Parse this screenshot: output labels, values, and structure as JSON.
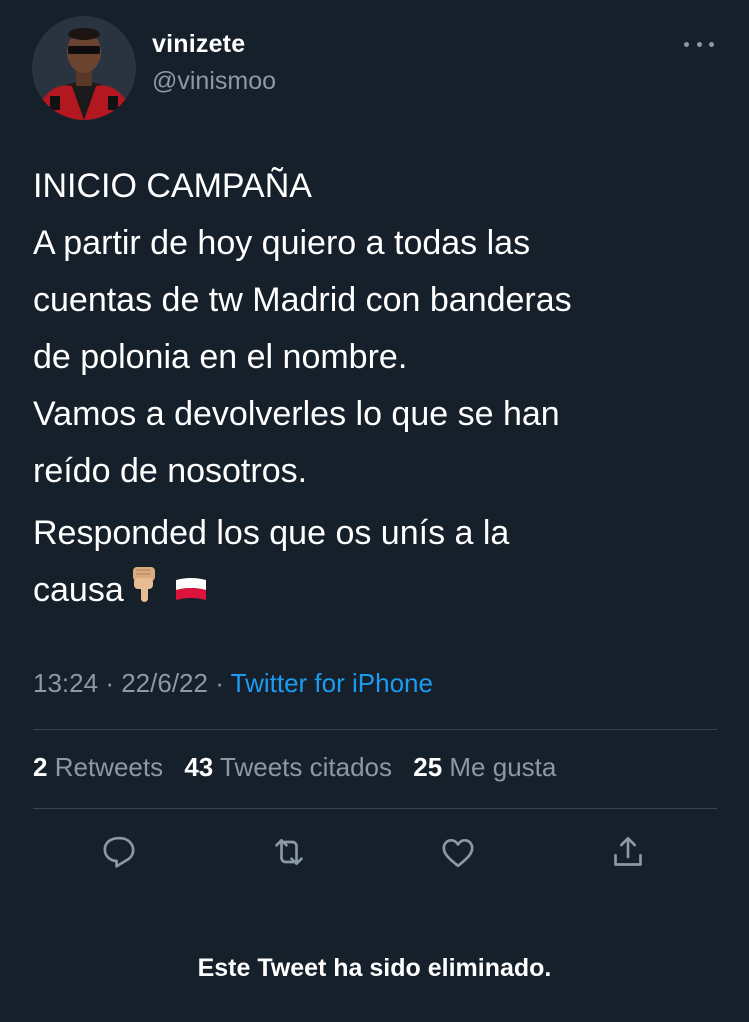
{
  "author": {
    "display_name": "vinizete",
    "handle": "@vinismoo"
  },
  "tweet": {
    "lines": [
      "INICIO CAMPAÑA",
      "A partir de hoy quiero a todas las",
      "cuentas de tw Madrid con banderas",
      "de polonia en el nombre.",
      "Vamos a devolverles lo que se han",
      "reído de nosotros."
    ],
    "para2_line1": "Responded los que os unís a la",
    "para2_line2": "causa",
    "emojis": [
      "backhand-index-pointing-down",
      "flag-poland"
    ]
  },
  "meta": {
    "time": "13:24",
    "separator": "·",
    "date": "22/6/22",
    "source": "Twitter for iPhone"
  },
  "stats": {
    "retweets_count": "2",
    "retweets_label": "Retweets",
    "quotes_count": "43",
    "quotes_label": "Tweets citados",
    "likes_count": "25",
    "likes_label": "Me gusta"
  },
  "actions": [
    "reply-icon",
    "retweet-icon",
    "like-icon",
    "share-icon"
  ],
  "notice": "Este Tweet ha sido eliminado.",
  "colors": {
    "background": "#15202b",
    "text": "#ffffff",
    "secondary": "#8b98a5",
    "link": "#1d9bf0",
    "divider": "#38444d"
  }
}
